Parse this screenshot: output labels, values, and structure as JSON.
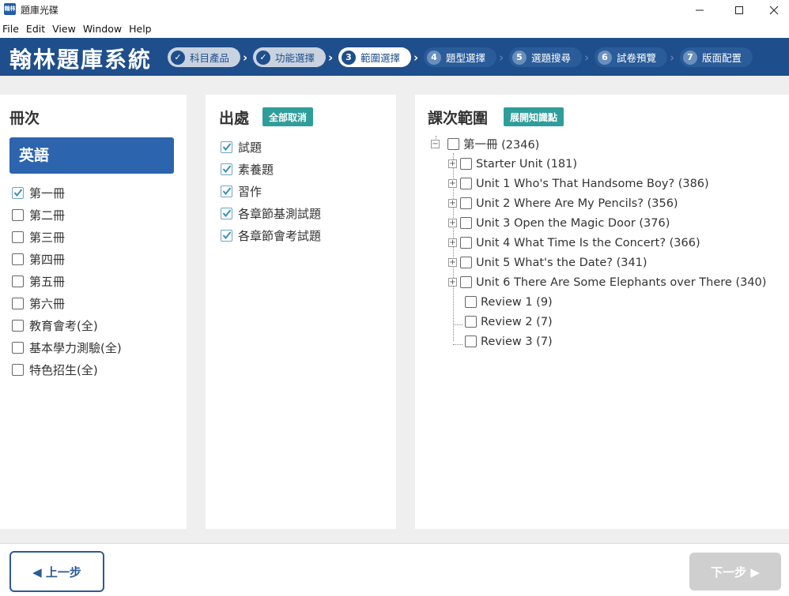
{
  "window": {
    "title": "題庫光碟",
    "icon_label": "翰林"
  },
  "menu": [
    "File",
    "Edit",
    "View",
    "Window",
    "Help"
  ],
  "header": {
    "logo": "翰林題庫系統",
    "steps": [
      {
        "num": "✓",
        "label": "科目產品",
        "state": "done"
      },
      {
        "num": "✓",
        "label": "功能選擇",
        "state": "done"
      },
      {
        "num": "3",
        "label": "範圍選擇",
        "state": "active"
      },
      {
        "num": "4",
        "label": "題型選擇",
        "state": "todo"
      },
      {
        "num": "5",
        "label": "選題搜尋",
        "state": "todo"
      },
      {
        "num": "6",
        "label": "試卷預覽",
        "state": "todo"
      },
      {
        "num": "7",
        "label": "版面配置",
        "state": "todo"
      }
    ]
  },
  "volume_panel": {
    "title": "冊次",
    "subject": "英語",
    "items": [
      {
        "label": "第一冊",
        "checked": true
      },
      {
        "label": "第二冊",
        "checked": false
      },
      {
        "label": "第三冊",
        "checked": false
      },
      {
        "label": "第四冊",
        "checked": false
      },
      {
        "label": "第五冊",
        "checked": false
      },
      {
        "label": "第六冊",
        "checked": false
      },
      {
        "label": "教育會考(全)",
        "checked": false
      },
      {
        "label": "基本學力測驗(全)",
        "checked": false
      },
      {
        "label": "特色招生(全)",
        "checked": false
      }
    ]
  },
  "source_panel": {
    "title": "出處",
    "button": "全部取消",
    "items": [
      {
        "label": "試題",
        "checked": true
      },
      {
        "label": "素養題",
        "checked": true
      },
      {
        "label": "習作",
        "checked": true
      },
      {
        "label": "各章節基測試題",
        "checked": true
      },
      {
        "label": "各章節會考試題",
        "checked": true
      }
    ]
  },
  "lesson_panel": {
    "title": "課次範圍",
    "button": "展開知識點",
    "root": {
      "label": "第一冊 (2346)",
      "toggle": "−"
    },
    "children": [
      {
        "label": "Starter Unit (181)",
        "toggle": "+"
      },
      {
        "label": "Unit 1 Who's That Handsome Boy? (386)",
        "toggle": "+"
      },
      {
        "label": "Unit 2 Where Are My Pencils? (356)",
        "toggle": "+"
      },
      {
        "label": "Unit 3 Open the Magic Door (376)",
        "toggle": "+"
      },
      {
        "label": "Unit 4 What Time Is the Concert? (366)",
        "toggle": "+"
      },
      {
        "label": "Unit 5 What's the Date? (341)",
        "toggle": "+"
      },
      {
        "label": "Unit 6 There Are Some Elephants over There (340)",
        "toggle": "+"
      },
      {
        "label": "Review 1 (9)",
        "toggle": ""
      },
      {
        "label": "Review 2 (7)",
        "toggle": ""
      },
      {
        "label": "Review 3 (7)",
        "toggle": ""
      }
    ]
  },
  "footer": {
    "prev": "◀ 上一步",
    "next": "下一步 ▶"
  }
}
